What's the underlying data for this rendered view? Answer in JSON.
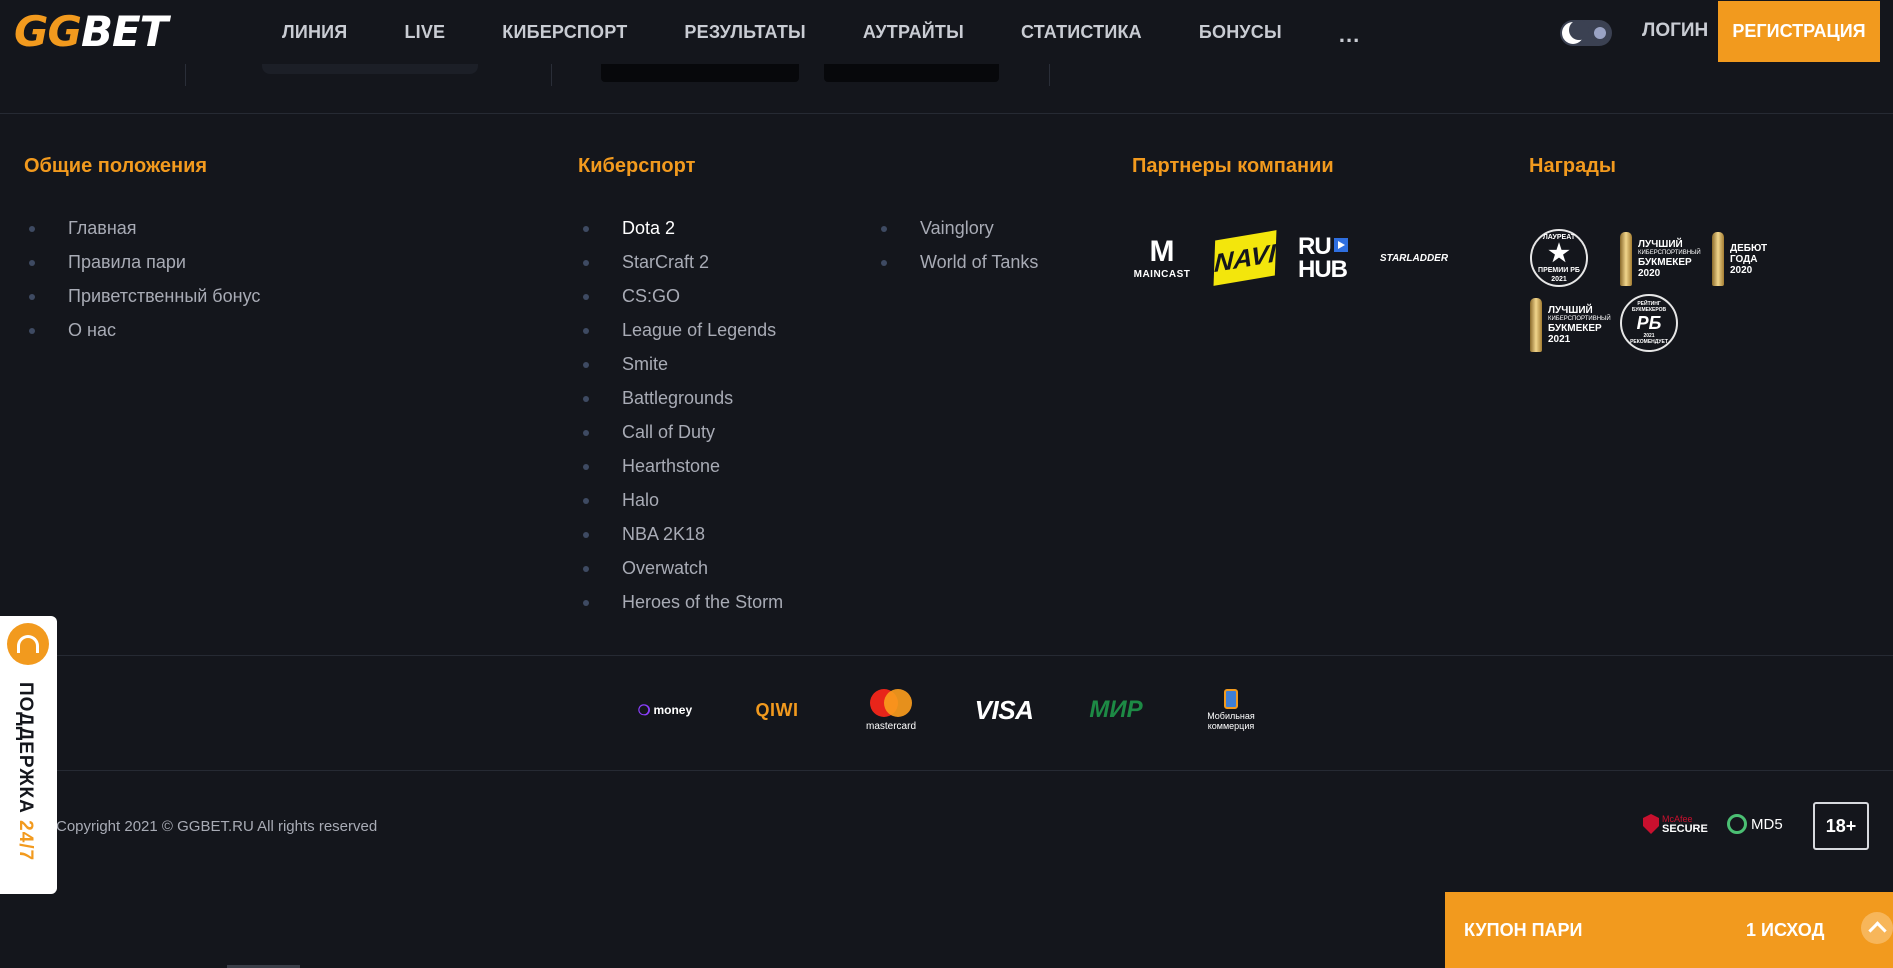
{
  "header": {
    "logo_gg": "GG",
    "logo_bet": "BET",
    "nav": [
      "ЛИНИЯ",
      "LIVE",
      "КИБЕРСПОРТ",
      "РЕЗУЛЬТАТЫ",
      "АУТРАЙТЫ",
      "СТАТИСТИКА",
      "БОНУСЫ"
    ],
    "more": "...",
    "login": "ЛОГИН",
    "register": "РЕГИСТРАЦИЯ"
  },
  "footer": {
    "general": {
      "title": "Общие положения",
      "items": [
        "Главная",
        "Правила пари",
        "Приветственный бонус",
        "О нас"
      ]
    },
    "esports": {
      "title": "Киберспорт",
      "col1": [
        "Dota 2",
        "StarCraft 2",
        "CS:GO",
        "League of Legends",
        "Smite",
        "Battlegrounds",
        "Call of Duty",
        "Hearthstone",
        "Halo",
        "NBA 2K18",
        "Overwatch",
        "Heroes of the Storm"
      ],
      "col2": [
        "Vainglory",
        "World of Tanks"
      ],
      "active": "Dota 2"
    },
    "partners": {
      "title": "Партнеры компании",
      "maincast_mark": "M",
      "maincast_text": "MAINCAST",
      "navi": "NAVI",
      "ruhub_top": "RU",
      "ruhub_bottom": "HUB",
      "starladder": "STARLADDER"
    },
    "awards": {
      "title": "Награды",
      "laureate": {
        "top": "ЛАУРЕАТ",
        "bottom": "ПРЕМИИ РБ 2021"
      },
      "best2020": {
        "line1": "ЛУЧШИЙ",
        "small": "КИБЕРСПОРТИВНЫЙ",
        "line2": "БУКМЕКЕР",
        "year": "2020"
      },
      "debut": {
        "line1": "ДЕБЮТ",
        "line2": "ГОДА",
        "year": "2020"
      },
      "best2021": {
        "line1": "ЛУЧШИЙ",
        "small": "КИБЕРСПОРТИВНЫЙ",
        "line2": "БУКМЕКЕР",
        "year": "2021"
      },
      "rating": {
        "top": "РЕЙТИНГ БУКМЕКЕРОВ",
        "mark": "РБ",
        "year": "2021",
        "bottom": "РЕКОМЕНДУЕТ"
      }
    },
    "payments": {
      "money": "money",
      "qiwi": "QIWI",
      "mastercard": "mastercard",
      "visa": "VISA",
      "mir": "МИР",
      "mobile": "Мобильная коммерция"
    },
    "copyright": "Copyright 2021 © GGBET.RU All rights reserved",
    "mcafee_top": "McAfee",
    "mcafee_bottom": "SECURE",
    "md5": "MD5",
    "age": "18+"
  },
  "support": {
    "label": "ПОДДЕРЖКА",
    "hours": "24/7"
  },
  "coupon": {
    "title": "КУПОН ПАРИ",
    "count": "1 ИСХОД"
  },
  "colors": {
    "accent": "#f29a1e",
    "background": "#14161c",
    "text": "#a8abb5"
  }
}
